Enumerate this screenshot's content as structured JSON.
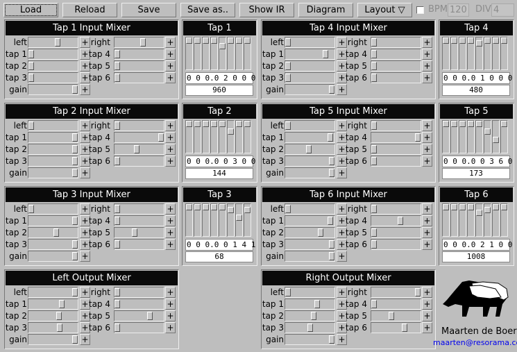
{
  "toolbar": {
    "load": "Load",
    "reload": "Reload",
    "save": "Save",
    "save_as": "Save as..",
    "show_ir": "Show IR",
    "diagram": "Diagram",
    "layout": "Layout ▽",
    "bpm_label": "BPM",
    "bpm_value": "120",
    "bpm_checked": false,
    "div_label": "DIV",
    "div_value": "4"
  },
  "mixers": [
    {
      "title": "Tap 1 Input Mixer",
      "left": [
        [
          "left",
          0.6
        ],
        [
          "tap 1",
          0
        ],
        [
          "tap 2",
          0
        ],
        [
          "tap 3",
          0
        ],
        [
          "gain",
          1.0
        ]
      ],
      "right": [
        [
          "right",
          0.58
        ],
        [
          "tap 4",
          0
        ],
        [
          "tap 5",
          0
        ],
        [
          "tap 6",
          0
        ]
      ]
    },
    {
      "title": "Tap 4 Input Mixer",
      "left": [
        [
          "left",
          0
        ],
        [
          "tap 1",
          0.85
        ],
        [
          "tap 2",
          0
        ],
        [
          "tap 3",
          0
        ],
        [
          "gain",
          1.0
        ]
      ],
      "right": [
        [
          "right",
          0
        ],
        [
          "tap 4",
          0
        ],
        [
          "tap 5",
          0
        ],
        [
          "tap 6",
          0
        ]
      ]
    },
    {
      "title": "Tap 2 Input Mixer",
      "left": [
        [
          "left",
          0
        ],
        [
          "tap 1",
          1.0
        ],
        [
          "tap 2",
          1.0
        ],
        [
          "tap 3",
          1.0
        ],
        [
          "gain",
          1.0
        ]
      ],
      "right": [
        [
          "right",
          0
        ],
        [
          "tap 4",
          1.0
        ],
        [
          "tap 5",
          0.45
        ],
        [
          "tap 6",
          0
        ]
      ]
    },
    {
      "title": "Tap 5 Input Mixer",
      "left": [
        [
          "left",
          0
        ],
        [
          "tap 1",
          0.97
        ],
        [
          "tap 2",
          0.48
        ],
        [
          "tap 3",
          1.0
        ],
        [
          "gain",
          1.0
        ]
      ],
      "right": [
        [
          "right",
          0
        ],
        [
          "tap 4",
          1.0
        ],
        [
          "tap 5",
          0
        ],
        [
          "tap 6",
          0
        ]
      ]
    },
    {
      "title": "Tap 3 Input Mixer",
      "left": [
        [
          "left",
          0
        ],
        [
          "tap 1",
          1.0
        ],
        [
          "tap 2",
          0.57
        ],
        [
          "tap 3",
          1.0
        ],
        [
          "gain",
          1.0
        ]
      ],
      "right": [
        [
          "right",
          0
        ],
        [
          "tap 4",
          0
        ],
        [
          "tap 5",
          0.4
        ],
        [
          "tap 6",
          0
        ]
      ]
    },
    {
      "title": "Tap 6 Input Mixer",
      "left": [
        [
          "left",
          0
        ],
        [
          "tap 1",
          0.97
        ],
        [
          "tap 2",
          0.75
        ],
        [
          "tap 3",
          1.0
        ],
        [
          "gain",
          1.0
        ]
      ],
      "right": [
        [
          "right",
          0
        ],
        [
          "tap 4",
          0.6
        ],
        [
          "tap 5",
          0
        ],
        [
          "tap 6",
          0
        ]
      ]
    },
    {
      "title": "Left Output Mixer",
      "left": [
        [
          "left",
          1.0
        ],
        [
          "tap 1",
          0.7
        ],
        [
          "tap 2",
          0.64
        ],
        [
          "tap 3",
          0.65
        ],
        [
          "gain",
          1.0
        ]
      ],
      "right": [
        [
          "right",
          0
        ],
        [
          "tap 4",
          0
        ],
        [
          "tap 5",
          0.75
        ],
        [
          "tap 6",
          0
        ]
      ]
    },
    {
      "title": "Right Output Mixer",
      "left": [
        [
          "left",
          0
        ],
        [
          "tap 1",
          0.67
        ],
        [
          "tap 2",
          0.58
        ],
        [
          "tap 3",
          0.5
        ],
        [
          "gain",
          1.0
        ]
      ],
      "right": [
        [
          "right",
          1.0
        ],
        [
          "tap 4",
          0
        ],
        [
          "tap 5",
          0.4
        ],
        [
          "tap 6",
          0.7
        ]
      ]
    }
  ],
  "taps": [
    {
      "title": "Tap 1",
      "digits": "0 0 0.0 2 0 0 0",
      "samples": "960"
    },
    {
      "title": "Tap 4",
      "digits": "0 0 0.0 1 0 0 0",
      "samples": "480"
    },
    {
      "title": "Tap 2",
      "digits": "0 0 0.0 0 3 0 0",
      "samples": "144"
    },
    {
      "title": "Tap 5",
      "digits": "0 0 0.0 0 3 6 0",
      "samples": "173"
    },
    {
      "title": "Tap 3",
      "digits": "0 0 0.0 0 1 4 1",
      "samples": "68"
    },
    {
      "title": "Tap 6",
      "digits": "0 0 0.0 2 1 0 0",
      "samples": "1008"
    }
  ],
  "plus_label": "+",
  "author": {
    "name": "Maarten de Boer",
    "email": "maarten@resorama.com"
  }
}
